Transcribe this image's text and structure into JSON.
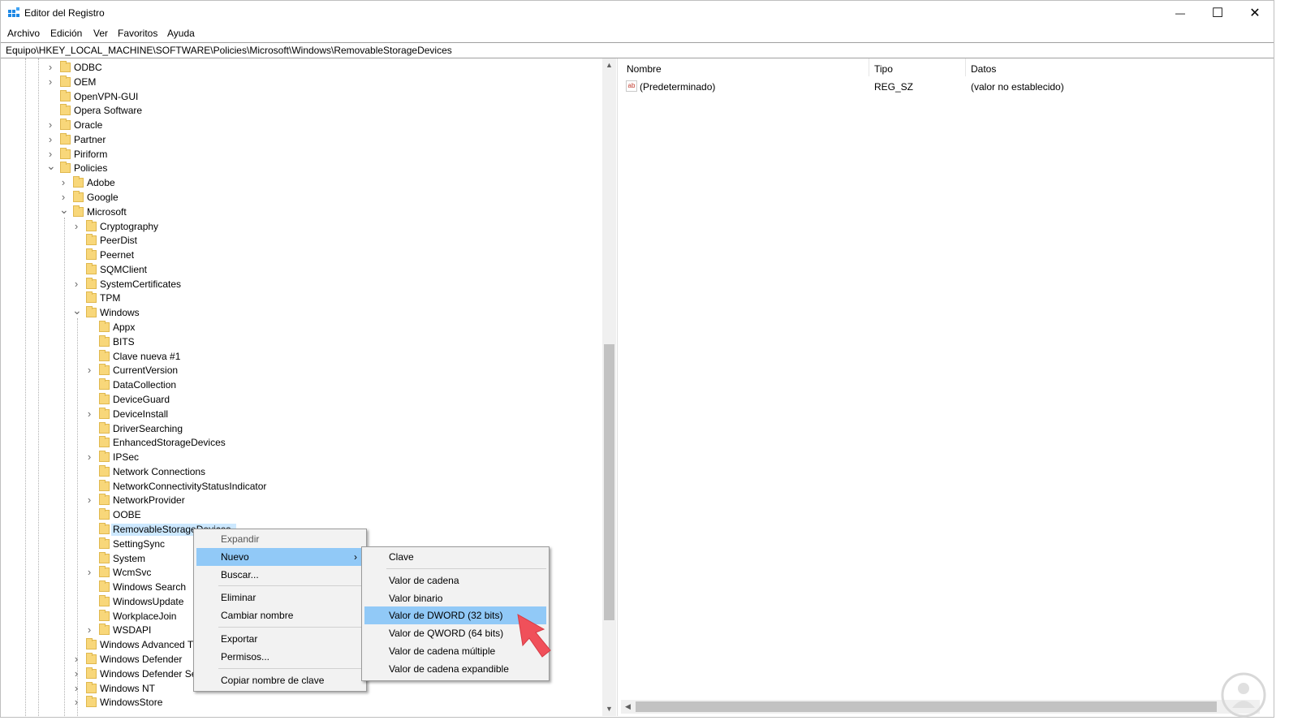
{
  "window": {
    "title": "Editor del Registro",
    "controls": {
      "minimize": "—",
      "maximize": "☐",
      "close": "✕"
    }
  },
  "menu": [
    "Archivo",
    "Edición",
    "Ver",
    "Favoritos",
    "Ayuda"
  ],
  "address": "Equipo\\HKEY_LOCAL_MACHINE\\SOFTWARE\\Policies\\Microsoft\\Windows\\RemovableStorageDevices",
  "tree": [
    {
      "label": "ODBC",
      "level": 0,
      "exp": "collapsed"
    },
    {
      "label": "OEM",
      "level": 0,
      "exp": "collapsed"
    },
    {
      "label": "OpenVPN-GUI",
      "level": 0,
      "exp": "none"
    },
    {
      "label": "Opera Software",
      "level": 0,
      "exp": "none"
    },
    {
      "label": "Oracle",
      "level": 0,
      "exp": "collapsed"
    },
    {
      "label": "Partner",
      "level": 0,
      "exp": "collapsed"
    },
    {
      "label": "Piriform",
      "level": 0,
      "exp": "collapsed"
    },
    {
      "label": "Policies",
      "level": 0,
      "exp": "expanded"
    },
    {
      "label": "Adobe",
      "level": 1,
      "exp": "collapsed"
    },
    {
      "label": "Google",
      "level": 1,
      "exp": "collapsed"
    },
    {
      "label": "Microsoft",
      "level": 1,
      "exp": "expanded"
    },
    {
      "label": "Cryptography",
      "level": 2,
      "exp": "collapsed"
    },
    {
      "label": "PeerDist",
      "level": 2,
      "exp": "none"
    },
    {
      "label": "Peernet",
      "level": 2,
      "exp": "none"
    },
    {
      "label": "SQMClient",
      "level": 2,
      "exp": "none"
    },
    {
      "label": "SystemCertificates",
      "level": 2,
      "exp": "collapsed"
    },
    {
      "label": "TPM",
      "level": 2,
      "exp": "none"
    },
    {
      "label": "Windows",
      "level": 2,
      "exp": "expanded"
    },
    {
      "label": "Appx",
      "level": 3,
      "exp": "none"
    },
    {
      "label": "BITS",
      "level": 3,
      "exp": "none"
    },
    {
      "label": "Clave nueva #1",
      "level": 3,
      "exp": "none"
    },
    {
      "label": "CurrentVersion",
      "level": 3,
      "exp": "collapsed"
    },
    {
      "label": "DataCollection",
      "level": 3,
      "exp": "none"
    },
    {
      "label": "DeviceGuard",
      "level": 3,
      "exp": "none"
    },
    {
      "label": "DeviceInstall",
      "level": 3,
      "exp": "collapsed"
    },
    {
      "label": "DriverSearching",
      "level": 3,
      "exp": "none"
    },
    {
      "label": "EnhancedStorageDevices",
      "level": 3,
      "exp": "none"
    },
    {
      "label": "IPSec",
      "level": 3,
      "exp": "collapsed"
    },
    {
      "label": "Network Connections",
      "level": 3,
      "exp": "none"
    },
    {
      "label": "NetworkConnectivityStatusIndicator",
      "level": 3,
      "exp": "none"
    },
    {
      "label": "NetworkProvider",
      "level": 3,
      "exp": "collapsed"
    },
    {
      "label": "OOBE",
      "level": 3,
      "exp": "none"
    },
    {
      "label": "RemovableStorageDevices",
      "level": 3,
      "exp": "none",
      "selected": true
    },
    {
      "label": "SettingSync",
      "level": 3,
      "exp": "none"
    },
    {
      "label": "System",
      "level": 3,
      "exp": "none"
    },
    {
      "label": "WcmSvc",
      "level": 3,
      "exp": "collapsed"
    },
    {
      "label": "Windows Search",
      "level": 3,
      "exp": "none"
    },
    {
      "label": "WindowsUpdate",
      "level": 3,
      "exp": "none"
    },
    {
      "label": "WorkplaceJoin",
      "level": 3,
      "exp": "none"
    },
    {
      "label": "WSDAPI",
      "level": 3,
      "exp": "collapsed"
    },
    {
      "label": "Windows Advanced Th",
      "level": 2,
      "exp": "none"
    },
    {
      "label": "Windows Defender",
      "level": 2,
      "exp": "collapsed"
    },
    {
      "label": "Windows Defender Sec",
      "level": 2,
      "exp": "collapsed"
    },
    {
      "label": "Windows NT",
      "level": 2,
      "exp": "collapsed"
    },
    {
      "label": "WindowsStore",
      "level": 2,
      "exp": "collapsed"
    }
  ],
  "values_pane": {
    "columns": [
      "Nombre",
      "Tipo",
      "Datos"
    ],
    "rows": [
      {
        "icon": "ab",
        "name": "(Predeterminado)",
        "type": "REG_SZ",
        "data": "(valor no establecido)"
      }
    ]
  },
  "context_menu": {
    "items": [
      {
        "label": "Expandir",
        "dim": true
      },
      {
        "label": "Nuevo",
        "highlighted": true,
        "submenu": true
      },
      {
        "label": "Buscar..."
      },
      {
        "sep": true
      },
      {
        "label": "Eliminar"
      },
      {
        "label": "Cambiar nombre"
      },
      {
        "sep": true
      },
      {
        "label": "Exportar"
      },
      {
        "label": "Permisos..."
      },
      {
        "sep": true
      },
      {
        "label": "Copiar nombre de clave"
      }
    ]
  },
  "submenu": {
    "items": [
      {
        "label": "Clave"
      },
      {
        "sep": true
      },
      {
        "label": "Valor de cadena"
      },
      {
        "label": "Valor binario"
      },
      {
        "label": "Valor de DWORD (32 bits)",
        "highlighted": true
      },
      {
        "label": "Valor de QWORD (64 bits)"
      },
      {
        "label": "Valor de cadena múltiple"
      },
      {
        "label": "Valor de cadena expandible"
      }
    ]
  },
  "colors": {
    "highlight": "#91c9f7",
    "selection": "#cce8ff",
    "annotation_arrow": "#f0505a"
  }
}
